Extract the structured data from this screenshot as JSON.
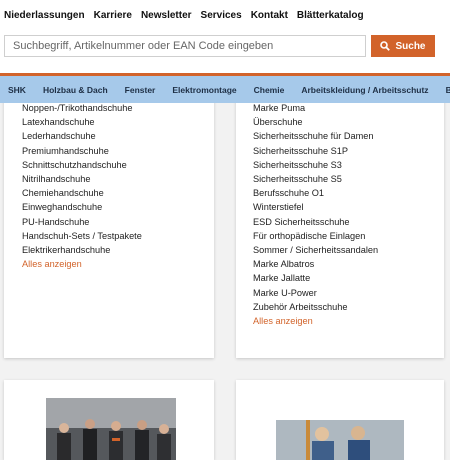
{
  "header": {
    "links": [
      "Niederlassungen",
      "Karriere",
      "Newsletter",
      "Services",
      "Kontakt",
      "Blätterkatalog"
    ],
    "search": {
      "placeholder": "Suchbegriff, Artikelnummer oder EAN Code eingeben",
      "button_label": "Suche",
      "button_icon": "search-icon"
    }
  },
  "nav": {
    "items": [
      "SHK",
      "Holzbau & Dach",
      "Fenster",
      "Elektromontage",
      "Chemie",
      "Arbeitskleidung / Arbeitsschutz",
      "Betriebsaus"
    ]
  },
  "left_card": {
    "items": [
      "Noppen-/Trikothandschuhe",
      "Latexhandschuhe",
      "Lederhandschuhe",
      "Premiumhandschuhe",
      "Schnittschutzhandschuhe",
      "Nitrilhandschuhe",
      "Chemiehandschuhe",
      "Einweghandschuhe",
      "PU-Handschuhe",
      "Handschuh-Sets / Testpakete",
      "Elektrikerhandschuhe"
    ],
    "more_label": "Alles anzeigen"
  },
  "right_card": {
    "items": [
      "Marke Puma",
      "Überschuhe",
      "Sicherheitsschuhe für Damen",
      "Sicherheitsschuhe S1P",
      "Sicherheitsschuhe S3",
      "Sicherheitsschuhe S5",
      "Berufsschuhe O1",
      "Winterstiefel",
      "ESD Sicherheitsschuhe",
      "Für orthopädische Einlagen",
      "Sommer / Sicherheitssandalen",
      "Marke Albatros",
      "Marke Jallatte",
      "Marke U-Power",
      "Zubehör Arbeitsschuhe"
    ],
    "more_label": "Alles anzeigen"
  },
  "colors": {
    "accent": "#d2632a",
    "nav_background": "#a6c9ea",
    "page_background": "#f2f2f2"
  }
}
